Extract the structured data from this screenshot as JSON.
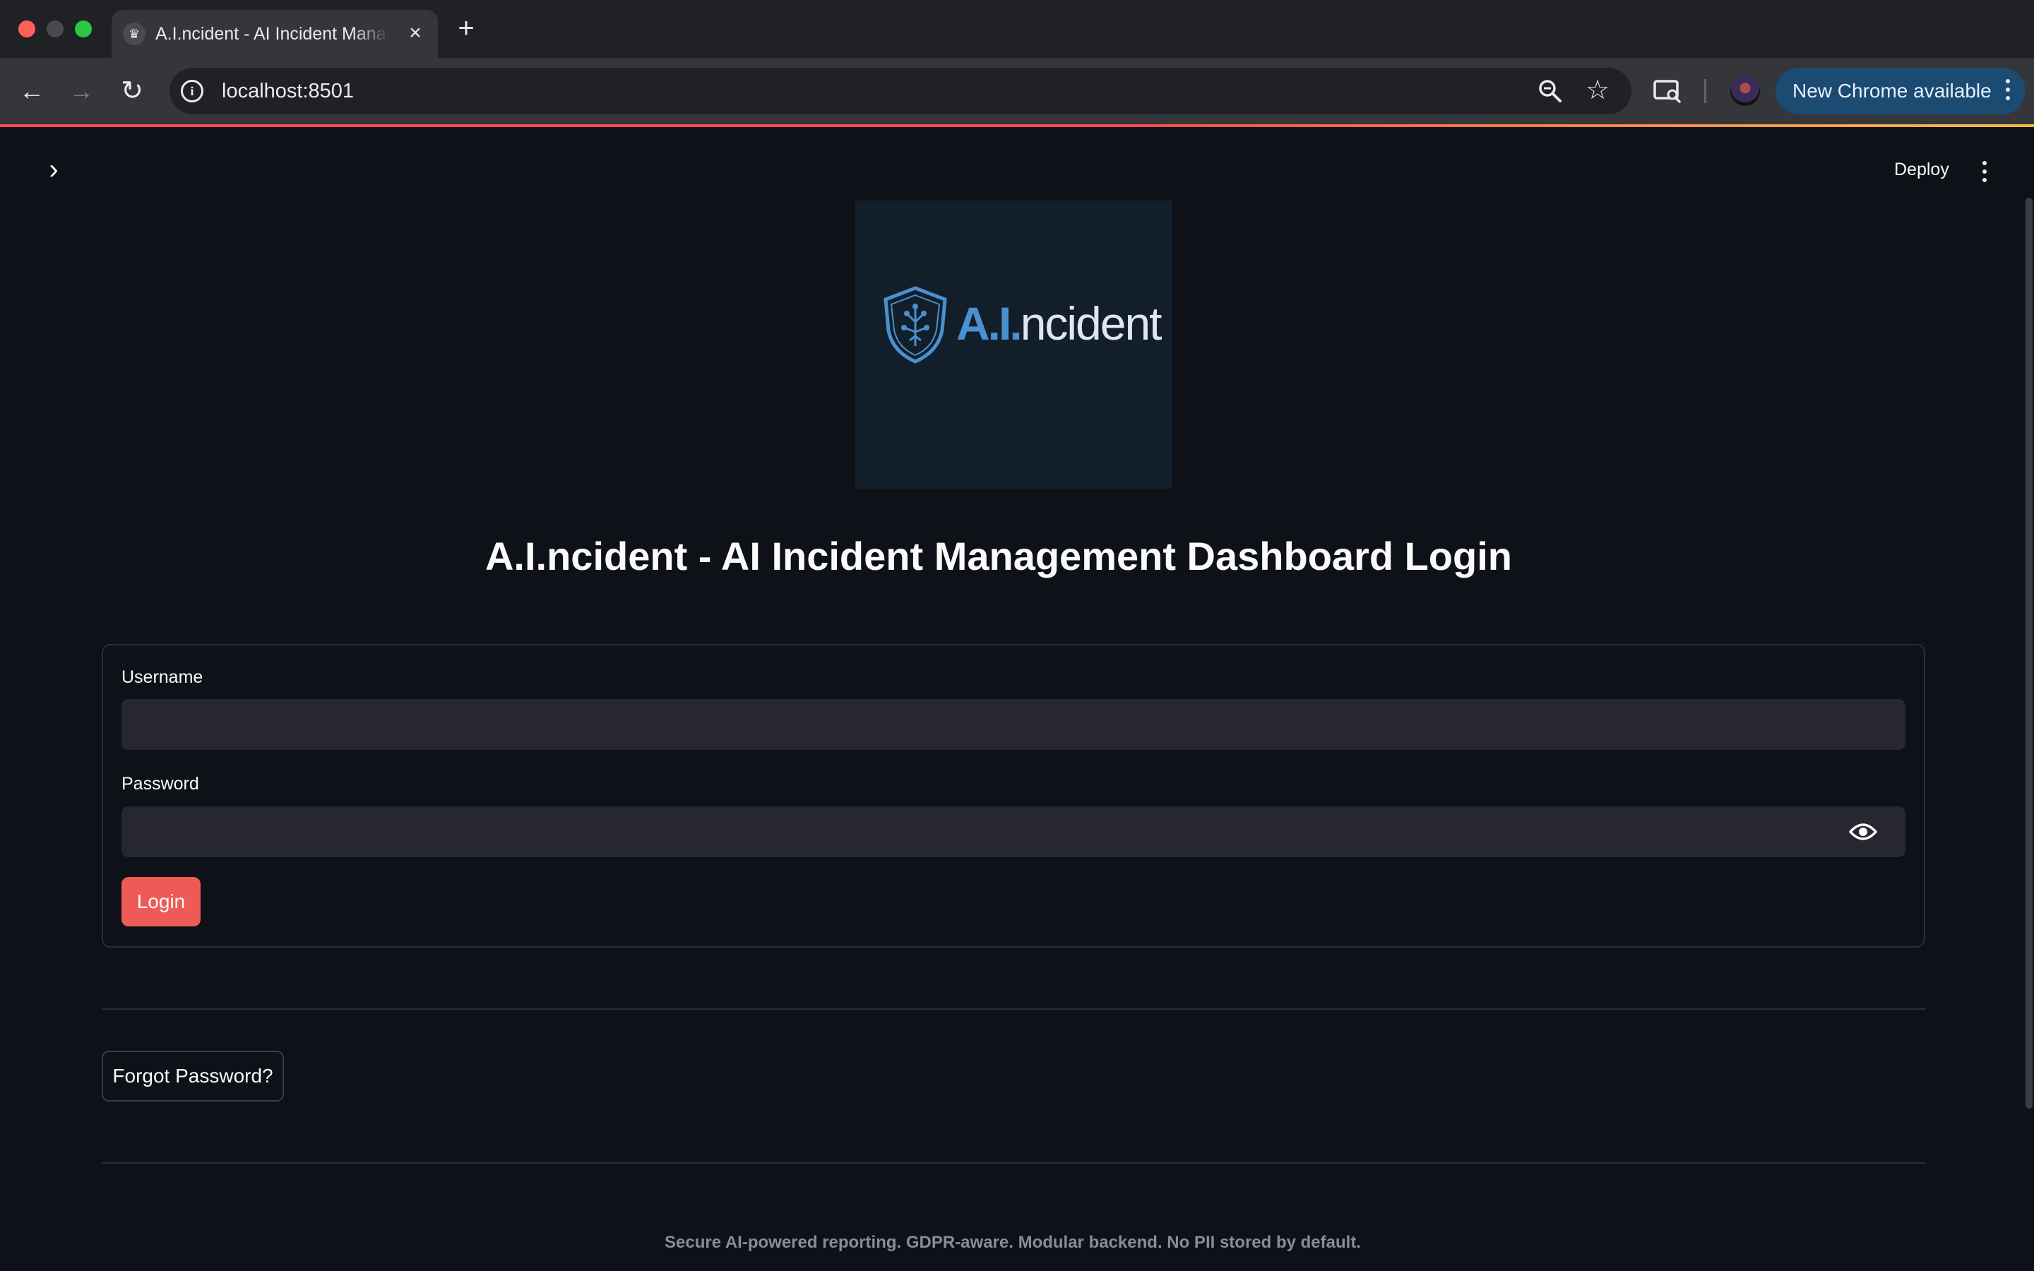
{
  "browser": {
    "tab_title": "A.I.ncident - AI Incident Management Dashboard",
    "tab_favicon": "crown-icon",
    "url": "localhost:8501",
    "update_button_label": "New Chrome available",
    "icons": [
      "back-arrow-icon",
      "forward-arrow-icon",
      "reload-icon",
      "info-icon",
      "zoom-icon",
      "star-icon",
      "cast-icon",
      "avatar",
      "kebab-menu-icon"
    ]
  },
  "app": {
    "header": {
      "deploy_label": "Deploy"
    },
    "logo": {
      "text_accent": "A.I.",
      "text_rest": "ncident",
      "color_accent": "#4a90d0",
      "color_background": "#131e2b"
    },
    "title": "A.I.ncident - AI Incident Management Dashboard Login",
    "form": {
      "username_label": "Username",
      "username_value": "",
      "password_label": "Password",
      "password_value": "",
      "login_label": "Login"
    },
    "forgot_password_label": "Forgot Password?",
    "footer": "Secure AI-powered reporting. GDPR-aware. Modular backend. No PII stored by default.",
    "colors": {
      "primary_button": "#ee5b56",
      "background": "#0e1117",
      "input_background": "#262730"
    }
  }
}
